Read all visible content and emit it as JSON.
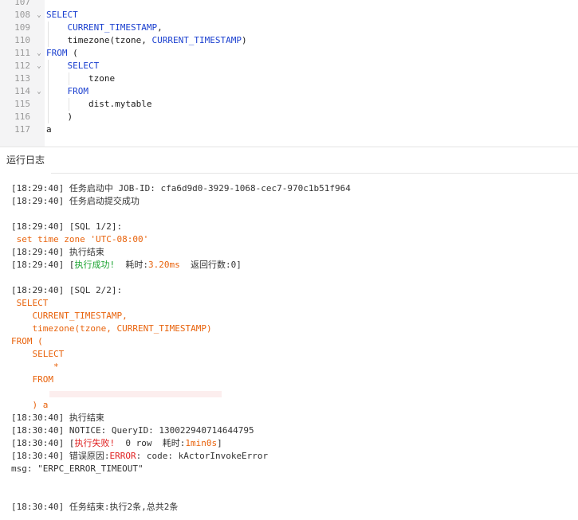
{
  "editor": {
    "lines": [
      {
        "num": "107",
        "fold": "",
        "tokens": []
      },
      {
        "num": "108",
        "fold": "⌄",
        "tokens": [
          {
            "t": "SELECT",
            "c": "kw"
          }
        ]
      },
      {
        "num": "109",
        "fold": "",
        "tokens": [
          {
            "t": "    CURRENT_TIMESTAMP",
            "c": "kw"
          },
          {
            "t": ",",
            "c": "pn"
          }
        ]
      },
      {
        "num": "110",
        "fold": "",
        "tokens": [
          {
            "t": "    timezone(tzone, ",
            "c": "id"
          },
          {
            "t": "CURRENT_TIMESTAMP",
            "c": "kw"
          },
          {
            "t": ")",
            "c": "pn"
          }
        ]
      },
      {
        "num": "111",
        "fold": "⌄",
        "tokens": [
          {
            "t": "FROM",
            "c": "kw"
          },
          {
            "t": " (",
            "c": "pn"
          }
        ]
      },
      {
        "num": "112",
        "fold": "⌄",
        "tokens": [
          {
            "t": "    SELECT",
            "c": "kw"
          }
        ]
      },
      {
        "num": "113",
        "fold": "",
        "tokens": [
          {
            "t": "        tzone",
            "c": "id"
          }
        ]
      },
      {
        "num": "114",
        "fold": "⌄",
        "tokens": [
          {
            "t": "    FROM",
            "c": "kw"
          }
        ]
      },
      {
        "num": "115",
        "fold": "",
        "tokens": [
          {
            "t": "        dist.mytable",
            "c": "id"
          }
        ]
      },
      {
        "num": "116",
        "fold": "",
        "tokens": [
          {
            "t": "    )",
            "c": "pn"
          }
        ]
      },
      {
        "num": "117",
        "fold": "",
        "tokens": [
          {
            "t": "a",
            "c": "id"
          }
        ]
      }
    ]
  },
  "panel": {
    "tab_label": "运行日志"
  },
  "log": [
    [
      {
        "t": "[18:29:40] 任务启动中 JOB-ID: cfa6d9d0-3929-1068-cec7-970c1b51f964",
        "c": ""
      }
    ],
    [
      {
        "t": "[18:29:40] 任务启动提交成功",
        "c": ""
      }
    ],
    [],
    [
      {
        "t": "[18:29:40] [SQL 1/2]:",
        "c": ""
      }
    ],
    [
      {
        "t": " set time zone 'UTC-08:00'",
        "c": "orange"
      }
    ],
    [
      {
        "t": "[18:29:40] 执行结束",
        "c": ""
      }
    ],
    [
      {
        "t": "[18:29:40] [",
        "c": ""
      },
      {
        "t": "执行成功!",
        "c": "green"
      },
      {
        "t": "  耗时:",
        "c": ""
      },
      {
        "t": "3.20ms",
        "c": "orange"
      },
      {
        "t": "  返回行数:0]",
        "c": ""
      }
    ],
    [],
    [
      {
        "t": "[18:29:40] [SQL 2/2]:",
        "c": ""
      }
    ],
    [
      {
        "t": " SELECT",
        "c": "orange"
      }
    ],
    [
      {
        "t": "    CURRENT_TIMESTAMP,",
        "c": "orange"
      }
    ],
    [
      {
        "t": "    timezone(tzone, CURRENT_TIMESTAMP)",
        "c": "orange"
      }
    ],
    [
      {
        "t": "FROM (",
        "c": "orange"
      }
    ],
    [
      {
        "t": "    SELECT",
        "c": "orange"
      }
    ],
    [
      {
        "t": "        *",
        "c": "orange"
      }
    ],
    [
      {
        "t": "    FROM",
        "c": "orange"
      }
    ],
    [],
    [
      {
        "t": "    ) a",
        "c": "orange"
      }
    ],
    [
      {
        "t": "[18:30:40] 执行结束",
        "c": ""
      }
    ],
    [
      {
        "t": "[18:30:40] NOTICE: QueryID: 130022940714644795",
        "c": ""
      }
    ],
    [
      {
        "t": "[18:30:40] [",
        "c": ""
      },
      {
        "t": "执行失败!",
        "c": "red"
      },
      {
        "t": "  0 row  耗时:",
        "c": ""
      },
      {
        "t": "1min0s",
        "c": "orange"
      },
      {
        "t": "]",
        "c": ""
      }
    ],
    [
      {
        "t": "[18:30:40] 错误原因:",
        "c": ""
      },
      {
        "t": "ERROR",
        "c": "red"
      },
      {
        "t": ": code: kActorInvokeError",
        "c": ""
      }
    ],
    [
      {
        "t": "msg: \"ERPC_ERROR_TIMEOUT\"",
        "c": ""
      }
    ],
    [],
    [],
    [
      {
        "t": "[18:30:40] 任务结束:执行2条,总共2条",
        "c": ""
      }
    ]
  ]
}
